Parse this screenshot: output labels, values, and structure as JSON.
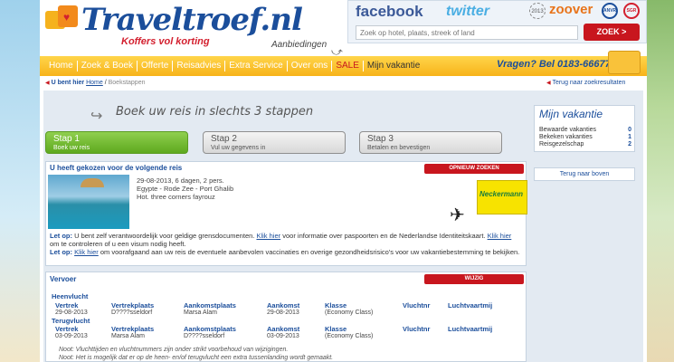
{
  "header": {
    "logo_text": "Traveltroef.nl",
    "tagline": "Koffers vol korting",
    "aanbiedingen": "Aanbiedingen",
    "social": {
      "facebook": "facebook",
      "twitter": "twitter",
      "zoover": "zoover",
      "anvr": "ANVR",
      "sgr": "SGR",
      "sun_badge": "2013"
    },
    "search_placeholder": "Zoek op hotel, plaats, streek of land",
    "search_button": "ZOEK >"
  },
  "nav": {
    "items": [
      "Home",
      "Zoek & Boek",
      "Offerte",
      "Reisadvies",
      "Extra Service",
      "Over ons",
      "SALE",
      "Mijn vakantie"
    ],
    "phone": "Vragen? Bel 0183-666777"
  },
  "breadcrumb": {
    "label": "U bent hier",
    "home": "Home",
    "current": "Boekstappen",
    "back": "Terug naar zoekresultaten"
  },
  "slogan": "Boek uw reis in slechts 3 stappen",
  "steps": [
    {
      "title": "Stap 1",
      "subtitle": "Boek uw reis",
      "active": true
    },
    {
      "title": "Stap 2",
      "subtitle": "Vul uw gegevens in",
      "active": false
    },
    {
      "title": "Stap 3",
      "subtitle": "Betalen en bevestigen",
      "active": false
    }
  ],
  "mijn_vakantie": {
    "title": "Mijn vakantie",
    "rows": [
      {
        "label": "Bewaarde vakanties",
        "count": "0"
      },
      {
        "label": "Bekeken vakanties",
        "count": "1"
      },
      {
        "label": "Reisgezelschap",
        "count": "2"
      }
    ],
    "back_top": "Terug naar boven"
  },
  "selection": {
    "title": "U heeft gekozen voor de volgende reis",
    "button": "OPNIEUW ZOEKEN",
    "line1": "29-08-2013, 6 dagen, 2 pers.",
    "line2": "Egypte - Rode Zee - Port Ghalib",
    "line3": "Hot. three corners fayrouz",
    "operator": "Neckermann",
    "notes": [
      {
        "prefix": "Let op:",
        "pre": " U bent zelf verantwoordelijk voor geldige grensdocumenten. ",
        "link": "Klik hier",
        "post": " voor informatie over paspoorten en de Nederlandse Identiteitskaart. ",
        "link2": "Klik hier",
        "post2": " om te controleren of u een visum nodig heeft."
      },
      {
        "prefix": "Let op:",
        "pre": " ",
        "link": "Klik hier",
        "post": " om voorafgaand aan uw reis de eventuele aanbevolen vaccinaties en overige gezondheidsrisico's voor uw vakantiebestemming te bekijken."
      }
    ]
  },
  "vervoer": {
    "title": "Vervoer",
    "button": "WIJZIG",
    "heenvlucht": "Heenvlucht",
    "terugvlucht": "Terugvlucht",
    "columns": [
      "Vertrek",
      "Vertrekplaats",
      "Aankomstplaats",
      "Aankomst",
      "Klasse",
      "Vluchtnr",
      "Luchtvaartmij"
    ],
    "heen": [
      "29-08-2013",
      "D????sseldorf",
      "Marsa Alam",
      "29-08-2013",
      "(Economy Class)",
      "",
      ""
    ],
    "terug": [
      "03-09-2013",
      "Marsa Alam",
      "D????sseldorf",
      "03-09-2013",
      "(Economy Class)",
      "",
      ""
    ],
    "note1": "Noot: Vluchttijden en vluchtnummers zijn onder strikt voorbehoud van wijzigingen.",
    "note2": "Noot: Het is mogelijk dat er op de heen- en/of terugvlucht een extra tussenlanding wordt gemaakt."
  }
}
